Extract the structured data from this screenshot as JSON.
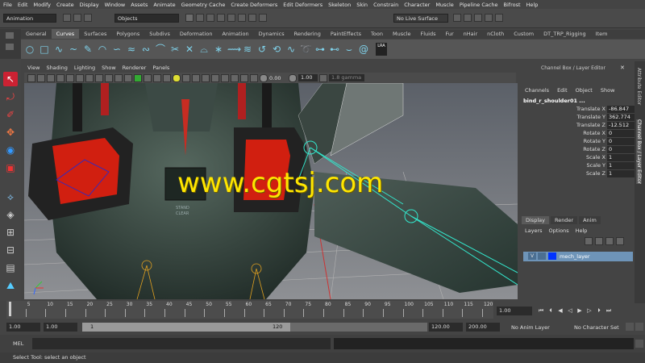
{
  "menubar": [
    "File",
    "Edit",
    "Modify",
    "Create",
    "Display",
    "Window",
    "Assets",
    "Animate",
    "Geometry Cache",
    "Create Deformers",
    "Edit Deformers",
    "Skeleton",
    "Skin",
    "Constrain",
    "Character",
    "Muscle",
    "Pipeline Cache",
    "Bifrost",
    "Help"
  ],
  "statusline": {
    "mode": "Animation",
    "select_mask": "Objects",
    "live_surface": "No Live Surface"
  },
  "shelf": {
    "tabs": [
      "General",
      "Curves",
      "Surfaces",
      "Polygons",
      "Subdivs",
      "Deformation",
      "Animation",
      "Dynamics",
      "Rendering",
      "PaintEffects",
      "Toon",
      "Muscle",
      "Fluids",
      "Fur",
      "nHair",
      "nCloth",
      "Custom",
      "DT_TRP_Rigging",
      "Item"
    ],
    "active_tab": "Curves",
    "lra_label": "LRA"
  },
  "panel": {
    "menus": [
      "View",
      "Shading",
      "Lighting",
      "Show",
      "Renderer",
      "Panels"
    ],
    "exposure": "0.00",
    "gamma_value": "1.00",
    "gamma_label": "1.8 gamma"
  },
  "viewport": {
    "decal_text_1": "STAND",
    "decal_text_2": "CLEAR",
    "watermark": "www.cgtsj.com"
  },
  "channel_box": {
    "title": "Channel Box / Layer Editor",
    "menus": [
      "Channels",
      "Edit",
      "Object",
      "Show"
    ],
    "object_name": "bind_r_shoulder01 ...",
    "attributes": [
      {
        "label": "Translate X",
        "value": "-86.847"
      },
      {
        "label": "Translate Y",
        "value": "362.774"
      },
      {
        "label": "Translate Z",
        "value": "-12.512"
      },
      {
        "label": "Rotate X",
        "value": "0"
      },
      {
        "label": "Rotate Y",
        "value": "0"
      },
      {
        "label": "Rotate Z",
        "value": "0"
      },
      {
        "label": "Scale X",
        "value": "1"
      },
      {
        "label": "Scale Y",
        "value": "1"
      },
      {
        "label": "Scale Z",
        "value": "1"
      }
    ]
  },
  "side_tabs": [
    "Attribute Editor",
    "Channel Box / Layer Editor"
  ],
  "layer_editor": {
    "tabs": [
      "Display",
      "Render",
      "Anim"
    ],
    "active_tab": "Display",
    "menus": [
      "Layers",
      "Options",
      "Help"
    ],
    "layer": {
      "visible": "V",
      "name": "mech_layer"
    }
  },
  "timeline": {
    "ticks": [
      "5",
      "10",
      "15",
      "20",
      "25",
      "30",
      "35",
      "40",
      "45",
      "50",
      "55",
      "60",
      "65",
      "70",
      "75",
      "80",
      "85",
      "90",
      "95",
      "100",
      "105",
      "110",
      "115",
      "120"
    ],
    "current_frame": "1.00"
  },
  "range": {
    "start": "1.00",
    "playback_start": "1.00",
    "slider_start": "1",
    "slider_end": "120",
    "playback_end": "120.00",
    "end": "200.00",
    "anim_layer": "No Anim Layer",
    "character_set": "No Character Set"
  },
  "command_line": {
    "label": "MEL"
  },
  "help_line": "Select Tool: select an object",
  "colors": {
    "accent_blue": "#0033ff",
    "layer_row": "#6e94b8",
    "joint_cyan": "#33e6cc",
    "watermark_yellow": "#ffe600"
  }
}
